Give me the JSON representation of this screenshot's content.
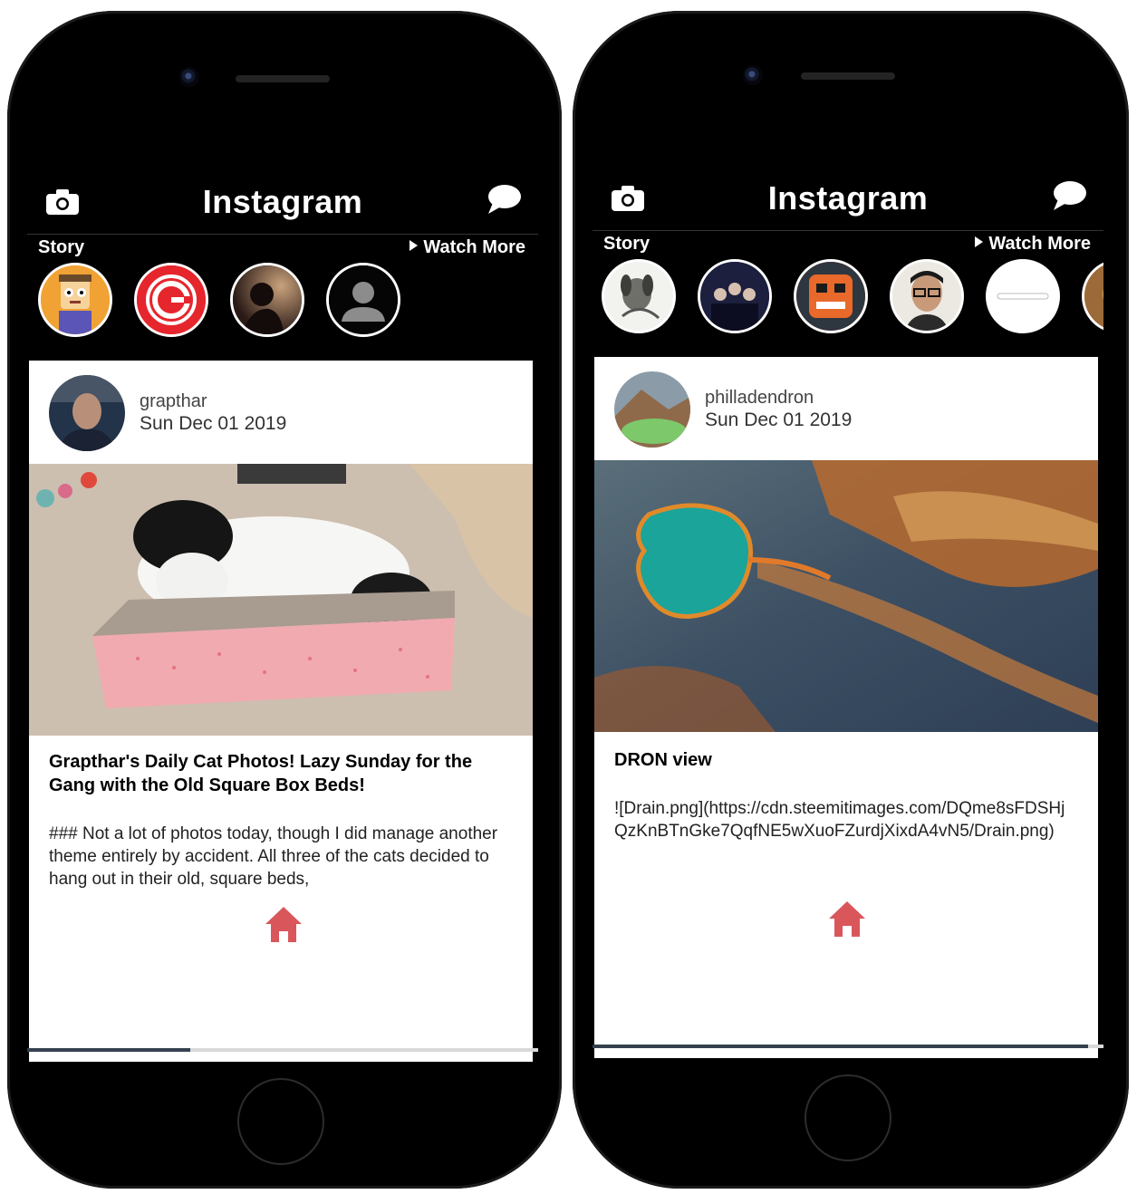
{
  "phones": [
    {
      "app_title": "Instagram",
      "story_label": "Story",
      "watch_more": "Watch More",
      "stories": [
        "avatar-cartoon",
        "avatar-red-g",
        "avatar-silhouette",
        "avatar-default"
      ],
      "post": {
        "username": "grapthar",
        "date": "Sun Dec 01 2019",
        "image": "cat-in-box-photo",
        "title": "Grapthar's Daily Cat Photos!  Lazy Sunday for the Gang with the Old Square Box Beds!",
        "body": "### Not a lot of photos today, though I did manage another theme entirely by accident.  All three of the cats decided to hang out in their old, square beds,"
      },
      "nav": [
        "profile-icon",
        "heart-icon",
        "home-icon",
        "plus-circle-icon",
        "search-icon"
      ],
      "active_nav": "home-icon",
      "progress": 0.32
    },
    {
      "app_title": "Instagram",
      "story_label": "Story",
      "watch_more": "Watch More",
      "stories": [
        "avatar-dog-sketch",
        "avatar-group",
        "avatar-robot",
        "avatar-man-glasses",
        "avatar-white-logo",
        "avatar-partial"
      ],
      "post": {
        "username": "philladendron",
        "date": "Sun Dec 01 2019",
        "image": "drone-lake-photo",
        "title": "DRON view",
        "body": "![Drain.png](https://cdn.steemitimages.com/DQme8sFDSHjQzKnBTnGke7QqfNE5wXuoFZurdjXixdA4vN5/Drain.png)"
      },
      "nav": [
        "profile-icon",
        "heart-icon",
        "home-icon",
        "plus-circle-icon",
        "search-icon"
      ],
      "active_nav": "home-icon",
      "progress": 0.97
    }
  ],
  "colors": {
    "accent": "#d9575b",
    "background": "#000000",
    "card": "#ffffff"
  }
}
